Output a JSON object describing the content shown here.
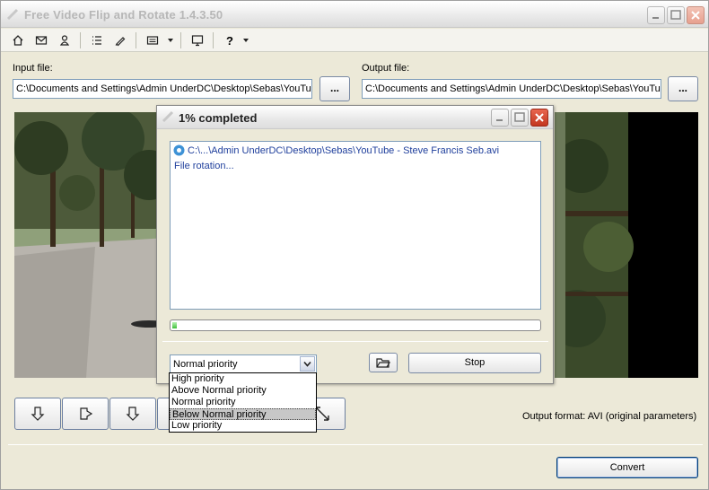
{
  "app": {
    "title": "Free Video Flip and Rotate 1.4.3.50"
  },
  "toolbar": {
    "icons": [
      "home-icon",
      "mail-icon",
      "user-icon",
      "list-icon",
      "brush-icon",
      "menu-icon",
      "monitor-icon",
      "help-icon"
    ],
    "help_label": "?"
  },
  "input": {
    "label": "Input file:",
    "value": "C:\\Documents and Settings\\Admin UnderDC\\Desktop\\Sebas\\YouTube",
    "browse_label": "..."
  },
  "output": {
    "label": "Output file:",
    "value": "C:\\Documents and Settings\\Admin UnderDC\\Desktop\\Sebas\\YouTube",
    "browse_label": "..."
  },
  "output_format": "Output format: AVI (original parameters)",
  "convert_label": "Convert",
  "dialog": {
    "title": "1% completed",
    "log": [
      "C:\\...\\Admin UnderDC\\Desktop\\Sebas\\YouTube - Steve Francis Seb.avi",
      "File rotation..."
    ],
    "progress_percent": 1,
    "priority_selected": "Normal priority",
    "stop_label": "Stop"
  },
  "priority_options": [
    "High priority",
    "Above Normal priority",
    "Normal priority",
    "Below Normal priority",
    "Low priority"
  ],
  "colors": {
    "accent": "#1f3f9c",
    "progress": "#3fbf3a",
    "close": "#c3371f"
  }
}
